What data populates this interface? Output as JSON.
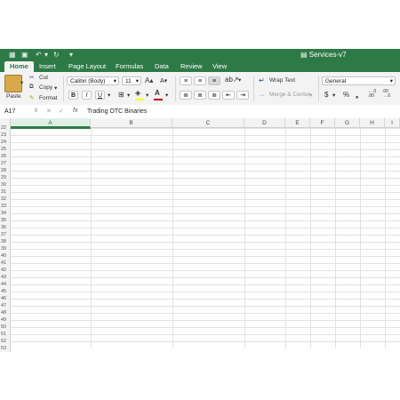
{
  "window": {
    "title": "Services-v7"
  },
  "tabs": [
    "Home",
    "Insert",
    "Page Layout",
    "Formulas",
    "Data",
    "Review",
    "View"
  ],
  "clipboard": {
    "paste": "Paste",
    "cut": "Cut",
    "copy": "Copy",
    "format": "Format"
  },
  "font": {
    "name": "Calibri (Body)",
    "size": "11",
    "bold": "B",
    "italic": "I",
    "underline": "U"
  },
  "alignment": {
    "wrap_text": "Wrap Text",
    "merge_center": "Merge & Center"
  },
  "number": {
    "format": "General",
    "currency": "$",
    "percent": "%"
  },
  "formula_bar": {
    "cell_ref": "A17",
    "fx": "fx",
    "value": "Trading OTC Binaries"
  },
  "columns": [
    "A",
    "B",
    "C",
    "D",
    "E",
    "F",
    "G",
    "H",
    "I"
  ],
  "rows": [
    "22",
    "23",
    "24",
    "25",
    "26",
    "27",
    "28",
    "29",
    "30",
    "31",
    "32",
    "33",
    "34",
    "35",
    "36",
    "37",
    "38",
    "39",
    "40",
    "41",
    "42",
    "43",
    "44",
    "45",
    "46",
    "47",
    "48",
    "49",
    "50",
    "51",
    "52",
    "53"
  ],
  "colors": {
    "excel_green": "#2e7a47",
    "ribbon_bg": "#f3f3f3",
    "font_color": "#c00000",
    "highlight": "#ffff00"
  }
}
